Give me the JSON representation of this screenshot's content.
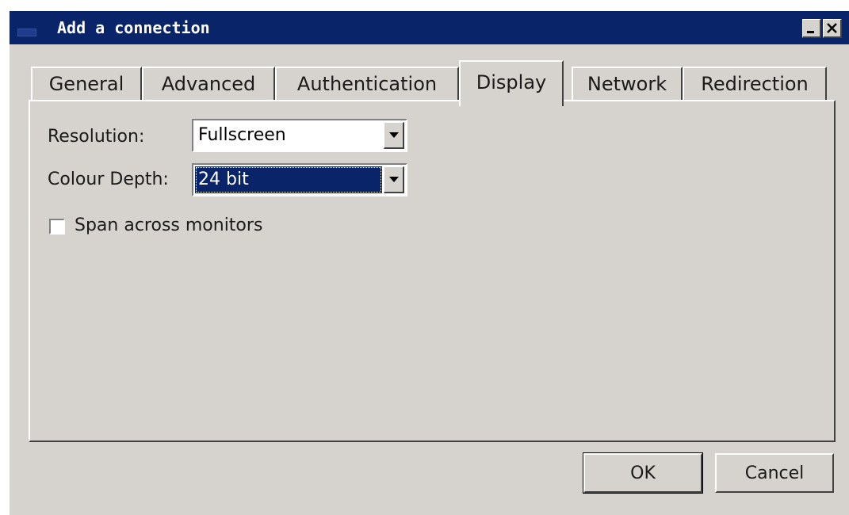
{
  "window": {
    "title": "Add a connection",
    "minimize_glyph": "minimize-icon",
    "close_glyph": "close-icon"
  },
  "tabs": [
    {
      "label": "General",
      "active": false
    },
    {
      "label": "Advanced",
      "active": false
    },
    {
      "label": "Authentication",
      "active": false
    },
    {
      "label": "Display",
      "active": true
    },
    {
      "label": "Network",
      "active": false
    },
    {
      "label": "Redirection",
      "active": false
    }
  ],
  "display": {
    "resolution_label": "Resolution:",
    "resolution_value": "Fullscreen",
    "colour_depth_label": "Colour Depth:",
    "colour_depth_value": "24 bit",
    "span_label": "Span across monitors",
    "span_checked": false
  },
  "buttons": {
    "ok": "OK",
    "cancel": "Cancel"
  },
  "colors": {
    "titlebar": "#0a246a",
    "face": "#d6d3ce",
    "selection": "#0a246a"
  }
}
